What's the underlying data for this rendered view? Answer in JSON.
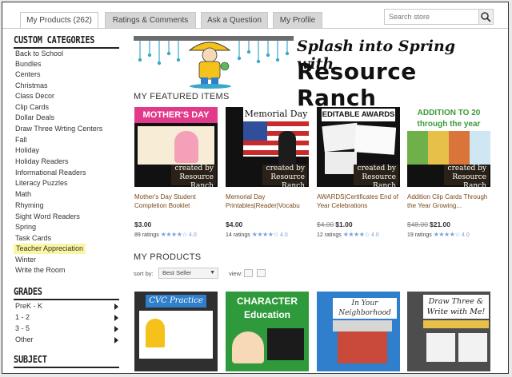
{
  "tabs": [
    {
      "label": "My Products (262)",
      "active": true
    },
    {
      "label": "Ratings & Comments",
      "active": false
    },
    {
      "label": "Ask a Question",
      "active": false
    },
    {
      "label": "My Profile",
      "active": false
    }
  ],
  "search": {
    "placeholder": "Search store"
  },
  "sidebar": {
    "custom_heading": "CUSTOM CATEGORIES",
    "categories": [
      "Back to School",
      "Bundles",
      "Centers",
      "Christmas",
      "Class Decor",
      "Clip Cards",
      "Dollar Deals",
      "Draw Three Wrting Centers",
      "Fall",
      "Holiday",
      "Holiday Readers",
      "Informational Readers",
      "Literacy Puzzles",
      "Math",
      "Rhyming",
      "Sight Word Readers",
      "Spring",
      "Task Cards",
      "Teacher Appreciation",
      "Winter",
      "Write the Room"
    ],
    "highlighted": "Teacher Appreciation",
    "grades_heading": "GRADES",
    "grades": [
      "PreK - K",
      "1 - 2",
      "3 - 5",
      "Other"
    ],
    "subject_heading": "SUBJECT"
  },
  "banner": {
    "line1": "Splash into Spring with",
    "line2": "Resource Ranch"
  },
  "featured": {
    "heading": "MY FEATURED ITEMS",
    "items": [
      {
        "image_text": "MOTHER'S DAY",
        "title": "Mother's Day Student Completion Booklet",
        "price": "$3.00",
        "old_price": "",
        "ratings": "89 ratings",
        "score": "4.0",
        "bg": "#e23a8a"
      },
      {
        "image_text": "Memorial Day",
        "title": "Memorial Day Printables|Reader|Vocabu",
        "price": "$4.00",
        "old_price": "",
        "ratings": "14 ratings",
        "score": "4.0",
        "bg": "#3a5fa8"
      },
      {
        "image_text": "EDITABLE AWARDS",
        "title": "AWARDS|Certificates End of Year Celebrations",
        "price": "$1.00",
        "old_price": "$4.00",
        "ratings": "12 ratings",
        "score": "4.0",
        "bg": "#2a2a2a"
      },
      {
        "image_text": "ADDITION TO 20 through the year",
        "title": "Addition Clip Cards Through the Year Growing...",
        "price": "$21.00",
        "old_price": "$48.00",
        "ratings": "19 ratings",
        "score": "4.0",
        "bg": "#3fa64a"
      }
    ],
    "brand_top": "created by",
    "brand_name": "Resource Ranch"
  },
  "products": {
    "heading": "MY PRODUCTS",
    "sort_label": "sort by:",
    "sort_value": "Best Seller",
    "view_label": "view:",
    "items": [
      {
        "image_text": "CVC Practice",
        "bg": "#2f2f2f"
      },
      {
        "image_text": "CHARACTER Education",
        "bg": "#2e9a3c"
      },
      {
        "image_text": "In Your Neighborhood",
        "bg": "#2f7fcc"
      },
      {
        "image_text": "Draw Three & Write with Me!",
        "bg": "#4d4d4d"
      }
    ]
  },
  "colors": {
    "accent_link": "#7a4b1a",
    "star": "#7aa0d6",
    "highlight": "#fbf7a0"
  }
}
